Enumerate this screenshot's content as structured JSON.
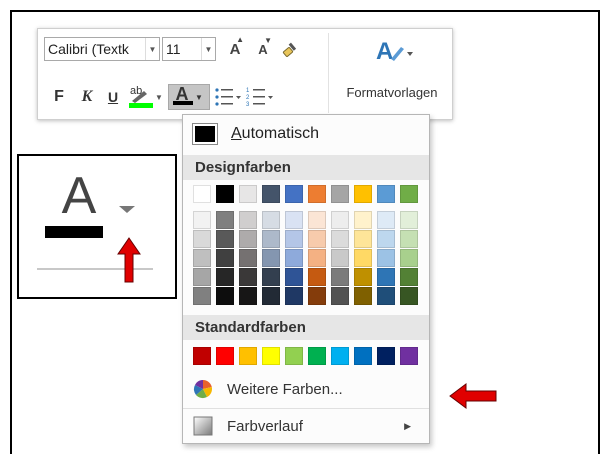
{
  "toolbar": {
    "font_name": "Calibri (Textk",
    "font_size": "11",
    "grow_font_icon": "font-grow-icon",
    "shrink_font_icon": "font-shrink-icon",
    "format_painter_icon": "format-painter-icon",
    "styles_label": "Formatvorlagen",
    "bold_label": "F",
    "italic_label": "K",
    "underline_label": "U",
    "highlight_label": "ab",
    "font_color_label": "A",
    "highlight_color": "#00ff00",
    "font_color": "#000000"
  },
  "inset": {
    "letter": "A"
  },
  "dropdown": {
    "automatic_label": "utomatisch",
    "automatic_accel": "A",
    "automatic_color": "#000000",
    "theme_header": "Designfarben",
    "theme_colors": [
      [
        "#ffffff",
        "#f2f2f2",
        "#d9d9d9",
        "#bfbfbf",
        "#a6a6a6",
        "#808080"
      ],
      [
        "#000000",
        "#7f7f7f",
        "#595959",
        "#404040",
        "#262626",
        "#0d0d0d"
      ],
      [
        "#e7e6e6",
        "#d0cece",
        "#aeabab",
        "#757171",
        "#3a3838",
        "#171616"
      ],
      [
        "#44546a",
        "#d6dce4",
        "#adb9ca",
        "#8496b0",
        "#333f4f",
        "#222a35"
      ],
      [
        "#4472c4",
        "#d9e2f3",
        "#b4c6e7",
        "#8eaadb",
        "#2f5496",
        "#1f3864"
      ],
      [
        "#ed7d31",
        "#fbe5d5",
        "#f7cbac",
        "#f4b183",
        "#c55a11",
        "#843c0b"
      ],
      [
        "#a5a5a5",
        "#ededed",
        "#dbdbdb",
        "#c9c9c9",
        "#7b7b7b",
        "#525252"
      ],
      [
        "#ffc000",
        "#fff2cc",
        "#fee599",
        "#ffd965",
        "#bf9000",
        "#7f6000"
      ],
      [
        "#5b9bd5",
        "#deeaf6",
        "#bdd7ee",
        "#9cc2e5",
        "#2e75b5",
        "#1f4e79"
      ],
      [
        "#70ad47",
        "#e2efd9",
        "#c5e0b3",
        "#a8d08d",
        "#538135",
        "#375623"
      ]
    ],
    "standard_header": "Standardfarben",
    "standard_colors": [
      "#c00000",
      "#ff0000",
      "#ffc000",
      "#ffff00",
      "#92d050",
      "#00b050",
      "#00b0f0",
      "#0070c0",
      "#002060",
      "#7030a0"
    ],
    "more_colors_label": "Weitere Farben...",
    "more_colors_icon": "color-wheel-icon",
    "gradient_label": "Farbverlauf",
    "gradient_icon": "gradient-icon",
    "gradient_submenu_icon": "chevron-right-icon"
  },
  "annotations": {
    "arrow_color": "#e00000"
  }
}
